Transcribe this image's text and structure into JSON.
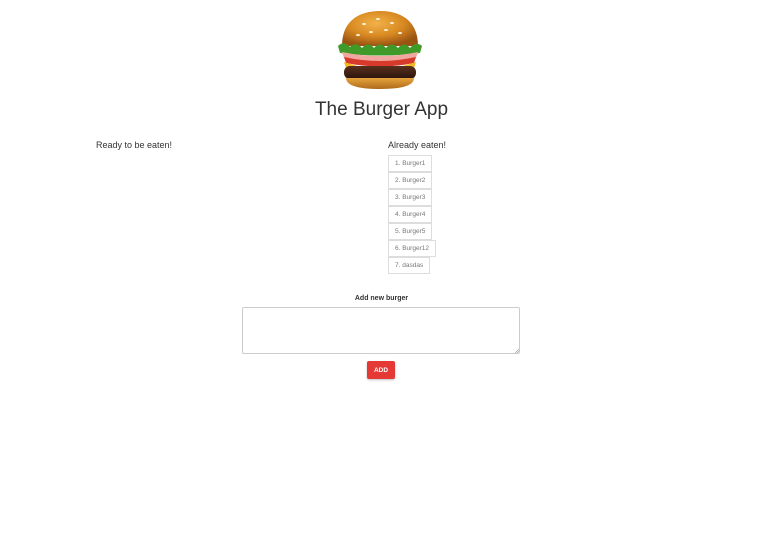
{
  "app": {
    "title": "The Burger App",
    "logo_icon": "burger-icon"
  },
  "ready": {
    "heading": "Ready to be eaten!",
    "items": []
  },
  "eaten": {
    "heading": "Already eaten!",
    "items": [
      "1. Burger1",
      "2. Burger2",
      "3. Burger3",
      "4. Burger4",
      "5. Burger5",
      "6. Burger12",
      "7. dasdas"
    ]
  },
  "form": {
    "label": "Add new burger",
    "input_value": "",
    "button_label": "ADD"
  },
  "colors": {
    "accent": "#e53935",
    "text": "#333333",
    "item_border": "#dddddd"
  }
}
